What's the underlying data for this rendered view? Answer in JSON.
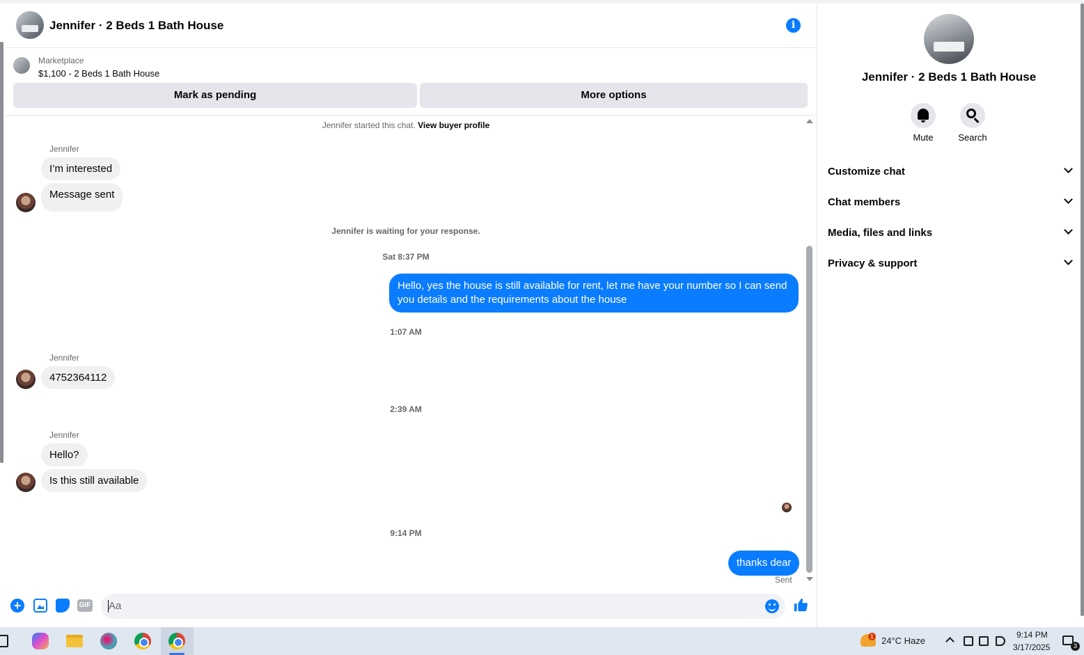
{
  "chat": {
    "title": "Jennifer · 2 Beds 1 Bath House",
    "info_icon_glyph": "i",
    "icons": {
      "info": "info-icon"
    }
  },
  "marketplace": {
    "label": "Marketplace",
    "item": "$1,100 - 2 Beds 1 Bath House",
    "pending_button": "Mark as pending",
    "more_button": "More options"
  },
  "thread": {
    "start_text": "Jennifer started this chat.",
    "start_link": "View buyer profile",
    "waiting_text": "Jennifer is waiting for your response.",
    "messages": [
      {
        "sender": "Jennifer",
        "text": "I’m interested"
      },
      {
        "text": "Message sent"
      },
      {
        "timestamp": "Sat 8:37 PM"
      },
      {
        "text": "Hello, yes the house is still available for rent, let me have your number so I can send you details and the requirements about the house"
      },
      {
        "timestamp": "1:07 AM"
      },
      {
        "sender": "Jennifer",
        "text": "4752364112"
      },
      {
        "timestamp": "2:39 AM"
      },
      {
        "sender": "Jennifer",
        "text": "Hello?"
      },
      {
        "text": "Is this still available"
      },
      {
        "timestamp": "9:14 PM"
      },
      {
        "text": "thanks dear"
      }
    ],
    "sent_label": "Sent"
  },
  "composer": {
    "placeholder": "Aa",
    "value": "",
    "plus_glyph": "+",
    "gif_label": "GIF",
    "like_glyph": "👍",
    "icons": [
      "plus-icon",
      "photo-icon",
      "sticker-icon",
      "gif-icon",
      "emoji-icon",
      "like-icon"
    ]
  },
  "info_panel": {
    "title": "Jennifer · 2 Beds 1 Bath House",
    "actions": [
      {
        "label": "Mute",
        "icon": "bell-icon"
      },
      {
        "label": "Search",
        "icon": "search-icon"
      }
    ],
    "sections": [
      "Customize chat",
      "Chat members",
      "Media, files and links",
      "Privacy & support"
    ]
  },
  "taskbar": {
    "weather_badge": "1",
    "weather": "24°C  Haze",
    "time": "9:14 PM",
    "date": "3/17/2025",
    "notification_count": "3"
  },
  "colors": {
    "accent": "#0a7cff",
    "incoming_bubble": "#f0f0f0",
    "button_bg": "#e4e6eb",
    "taskbar": "#dfe7f1"
  }
}
